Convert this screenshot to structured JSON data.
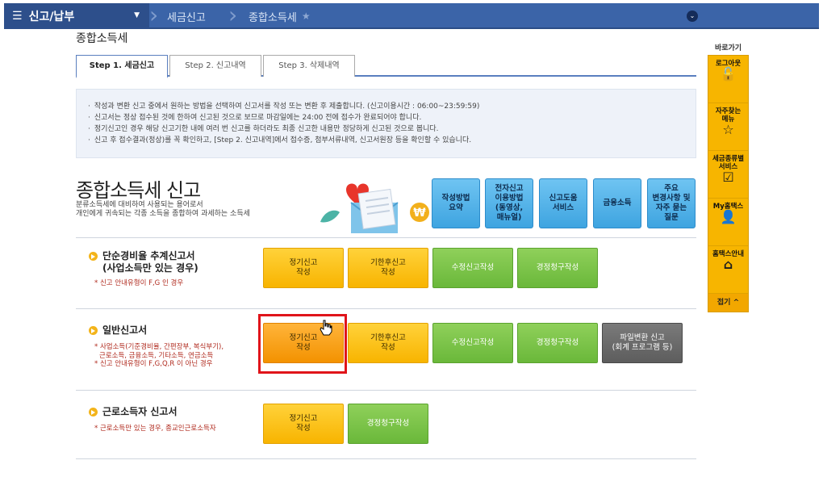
{
  "topbar": {
    "menu_icon": "☰",
    "menu_label": "신고/납부",
    "crumbs": [
      "세금신고",
      "종합소득세"
    ],
    "dropdown_icon": "⌄"
  },
  "page_title": "종합소득세",
  "tabs": [
    {
      "label": "Step 1. 세금신고",
      "active": true
    },
    {
      "label": "Step 2. 신고내역",
      "active": false
    },
    {
      "label": "Step 3. 삭제내역",
      "active": false
    }
  ],
  "notice": [
    "작성과 변환 신고 중에서 원하는 방법을 선택하여 신고서를 작성 또는 변환 후 제출합니다. (신고이용시간 : 06:00~23:59:59)",
    "신고서는 정상 접수된 것에 한하여 신고된 것으로 보므로 마감일에는 24:00 전에 접수가 완료되어야 합니다.",
    "정기신고인 경우 해당 신고기한 내에 여러 번 신고를 하더라도 최종 신고한 내용만 정당하게 신고된 것으로 봅니다.",
    "신고 후 접수결과(정상)를 꼭 확인하고, [Step 2. 신고내역]에서 접수증, 첨부서류내역, 신고서원장 등을 확인할 수 있습니다."
  ],
  "hero": {
    "title": "종합소득세 신고",
    "desc_line1": "분류소득세에 대비하여 사용되는 용어로서",
    "desc_line2": "개인에게 귀속되는 각종 소득을 종합하여 과세하는 소득세",
    "coin": "₩"
  },
  "quick_buttons": [
    {
      "label": "작성방법\n요약"
    },
    {
      "label": "전자신고\n이용방법\n(동영상,\n매뉴얼)"
    },
    {
      "label": "신고도움\n서비스"
    },
    {
      "label": "금융소득"
    },
    {
      "label": "주요\n변경사항 및\n자주 묻는\n질문"
    }
  ],
  "sections": {
    "simple": {
      "title_line1": "단순경비율 추계신고서",
      "title_line2": "(사업소득만 있는 경우)",
      "note": "* 신고 안내유형이 F,G 인 경우",
      "buttons": [
        "정기신고\n작성",
        "기한후신고\n작성",
        "수정신고작성",
        "경정청구작성"
      ]
    },
    "general": {
      "title": "일반신고서",
      "note_line1": "* 사업소득(기준경비율, 간편장부, 복식부기),",
      "note_line2": "근로소득, 금융소득, 기타소득, 연금소득",
      "note_line3": "* 신고 안내유형이 F,G,Q,R 이 아닌 경우",
      "buttons": [
        "정기신고\n작성",
        "기한후신고\n작성",
        "수정신고작성",
        "경정청구작성",
        "파일변환 신고\n(회계 프로그램 등)"
      ]
    },
    "labor": {
      "title": "근로소득자 신고서",
      "note": "* 근로소득만 있는 경우, 종교인근로소득자",
      "buttons": [
        "정기신고\n작성",
        "경정청구작성"
      ]
    }
  },
  "quick_panel": {
    "header": "바로가기",
    "items": [
      {
        "label": "로그아웃",
        "icon": "🔓"
      },
      {
        "label": "자주찾는\n메뉴",
        "icon": "☆"
      },
      {
        "label": "세금종류별\n서비스",
        "icon": "☑"
      },
      {
        "label": "My홈택스",
        "icon": "👤"
      },
      {
        "label": "홈택스안내",
        "icon": "⌂"
      }
    ],
    "close_label": "접기 ^"
  }
}
